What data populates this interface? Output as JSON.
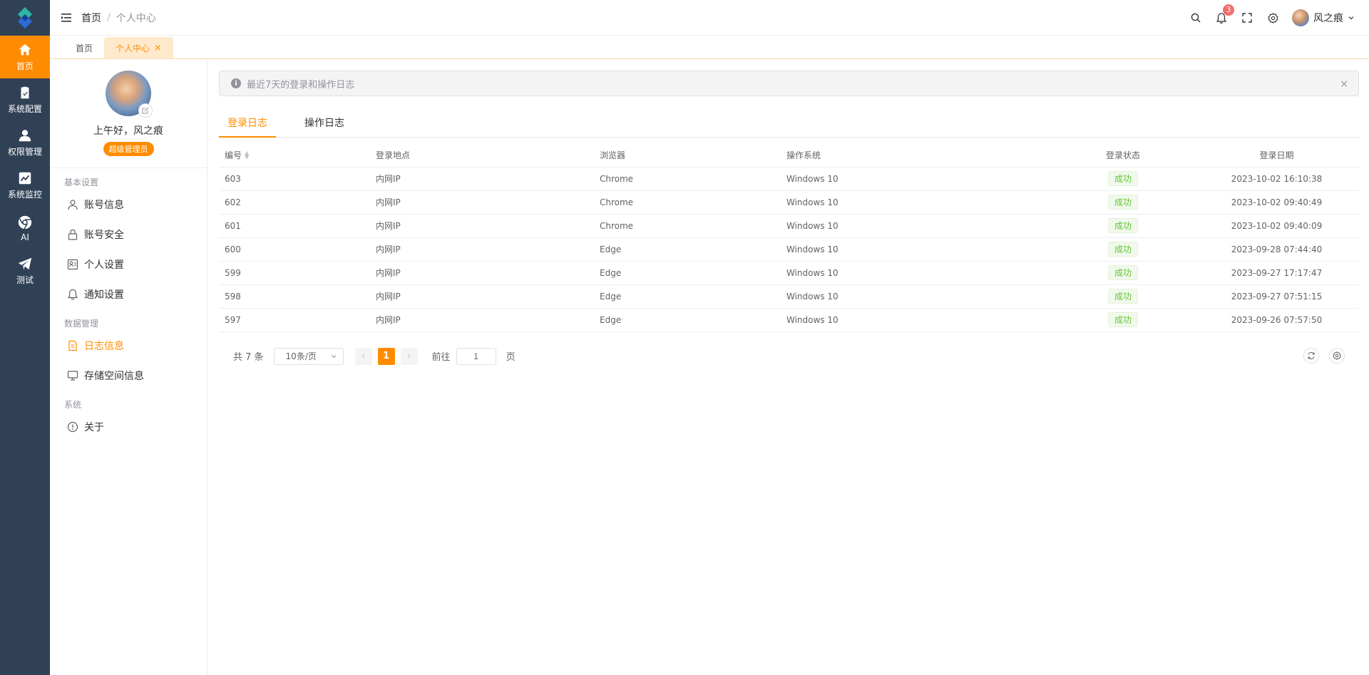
{
  "nav": {
    "items": [
      {
        "label": "首页",
        "icon": "home-icon"
      },
      {
        "label": "系统配置",
        "icon": "clipboard-icon"
      },
      {
        "label": "权限管理",
        "icon": "user-icon"
      },
      {
        "label": "系统监控",
        "icon": "chart-icon"
      },
      {
        "label": "AI",
        "icon": "chrome-icon"
      },
      {
        "label": "测试",
        "icon": "send-icon"
      }
    ]
  },
  "header": {
    "breadcrumb": {
      "home": "首页",
      "sep": "/",
      "current": "个人中心"
    },
    "notification_count": "3",
    "user_name": "风之痕"
  },
  "tags": {
    "home": "首页",
    "current": "个人中心",
    "close": "×"
  },
  "profile": {
    "greeting": "上午好，风之痕",
    "role": "超级管理员",
    "groups": {
      "basic": "基本设置",
      "data": "数据管理",
      "system": "系统"
    },
    "menu": {
      "account_info": "账号信息",
      "account_security": "账号安全",
      "personal_settings": "个人设置",
      "notify_settings": "通知设置",
      "log_info": "日志信息",
      "storage_info": "存储空间信息",
      "about": "关于"
    }
  },
  "alert": {
    "text": "最近7天的登录和操作日志",
    "close": "×"
  },
  "tabs": {
    "login_log": "登录日志",
    "op_log": "操作日志"
  },
  "table": {
    "headers": {
      "id": "编号",
      "location": "登录地点",
      "browser": "浏览器",
      "os": "操作系统",
      "status": "登录状态",
      "date": "登录日期"
    },
    "rows": [
      {
        "id": "603",
        "location": "内网IP",
        "browser": "Chrome",
        "os": "Windows 10",
        "status": "成功",
        "date": "2023-10-02 16:10:38"
      },
      {
        "id": "602",
        "location": "内网IP",
        "browser": "Chrome",
        "os": "Windows 10",
        "status": "成功",
        "date": "2023-10-02 09:40:49"
      },
      {
        "id": "601",
        "location": "内网IP",
        "browser": "Chrome",
        "os": "Windows 10",
        "status": "成功",
        "date": "2023-10-02 09:40:09"
      },
      {
        "id": "600",
        "location": "内网IP",
        "browser": "Edge",
        "os": "Windows 10",
        "status": "成功",
        "date": "2023-09-28 07:44:40"
      },
      {
        "id": "599",
        "location": "内网IP",
        "browser": "Edge",
        "os": "Windows 10",
        "status": "成功",
        "date": "2023-09-27 17:17:47"
      },
      {
        "id": "598",
        "location": "内网IP",
        "browser": "Edge",
        "os": "Windows 10",
        "status": "成功",
        "date": "2023-09-27 07:51:15"
      },
      {
        "id": "597",
        "location": "内网IP",
        "browser": "Edge",
        "os": "Windows 10",
        "status": "成功",
        "date": "2023-09-26 07:57:50"
      }
    ]
  },
  "pager": {
    "total": "共 7 条",
    "page_size": "10条/页",
    "prev": "‹",
    "current_page": "1",
    "next": "›",
    "goto_label": "前往",
    "goto_value": "1",
    "page_unit": "页"
  },
  "colors": {
    "accent": "#ff8c00",
    "sidebar": "#304156",
    "success": "#67c23a"
  }
}
